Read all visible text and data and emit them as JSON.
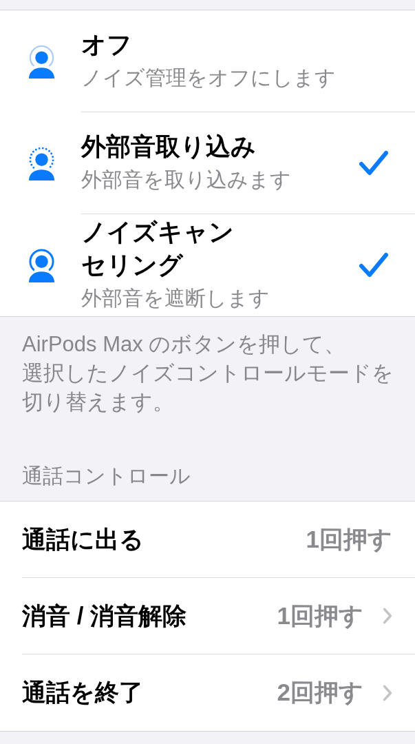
{
  "noise_control": {
    "options": [
      {
        "kind": "off",
        "title": "オフ",
        "subtitle": "ノイズ管理をオフにします",
        "checked": false
      },
      {
        "kind": "transparency",
        "title": "外部音取り込み",
        "subtitle": "外部音を取り込みます",
        "checked": true
      },
      {
        "kind": "noise_cancellation",
        "title": "ノイズキャンセリング",
        "subtitle": "外部音を遮断します",
        "checked": true
      }
    ],
    "footer": "AirPods Max のボタンを押して、選択したノイズコントロールモードを切り替えます。"
  },
  "call_controls": {
    "header": "通話コントロール",
    "rows": [
      {
        "label": "通話に出る",
        "value": "1回押す",
        "disclosure": false
      },
      {
        "label": "消音 / 消音解除",
        "value": "1回押す",
        "disclosure": true
      },
      {
        "label": "通話を終了",
        "value": "2回押す",
        "disclosure": true
      }
    ]
  }
}
